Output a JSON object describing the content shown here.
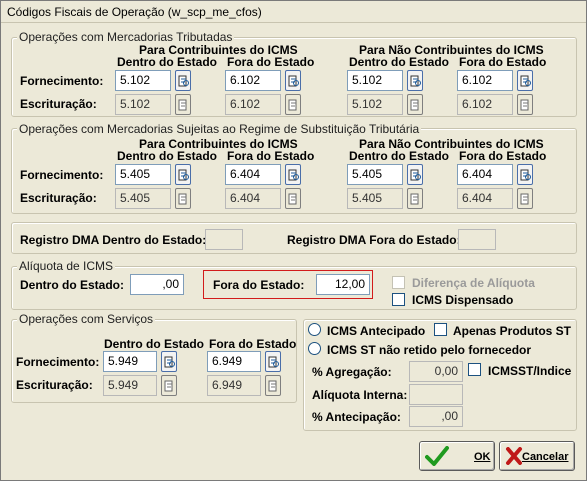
{
  "window": {
    "title": "Códigos Fiscais de Operação (w_scp_me_cfos)"
  },
  "tributadas": {
    "title": "Operações com Mercadorias Tributadas",
    "contribuintes": "Para Contribuintes do ICMS",
    "nao_contribuintes": "Para Não Contribuintes do ICMS",
    "dentro": "Dentro do Estado",
    "fora": "Fora do Estado",
    "fornecimento_label": "Fornecimento:",
    "escrituracao_label": "Escrituração:",
    "fornecimento": [
      "5.102",
      "6.102",
      "5.102",
      "6.102"
    ],
    "escrituracao": [
      "5.102",
      "6.102",
      "5.102",
      "6.102"
    ]
  },
  "st": {
    "title": "Operações com Mercadorias Sujeitas ao Regime de Substituição Tributária",
    "contribuintes": "Para Contribuintes do ICMS",
    "nao_contribuintes": "Para Não Contribuintes do ICMS",
    "dentro": "Dentro do Estado",
    "fora": "Fora do Estado",
    "fornecimento_label": "Fornecimento:",
    "escrituracao_label": "Escrituração:",
    "fornecimento": [
      "5.405",
      "6.404",
      "5.405",
      "6.404"
    ],
    "escrituracao": [
      "5.405",
      "6.404",
      "5.405",
      "6.404"
    ]
  },
  "dma": {
    "dentro_label": "Registro DMA Dentro do Estado:",
    "fora_label": "Registro DMA Fora do Estado:",
    "dentro_value": "",
    "fora_value": ""
  },
  "aliquota": {
    "title": "Alíquota de ICMS",
    "dentro_label": "Dentro do Estado:",
    "dentro_value": ",00",
    "fora_label": "Fora do Estado:",
    "fora_value": "12,00",
    "diferenca_label": "Diferença de Alíquota",
    "dispensado_label": "ICMS Dispensado"
  },
  "servicos": {
    "title": "Operações com Serviços",
    "dentro": "Dentro do Estado",
    "fora": "Fora do Estado",
    "fornecimento_label": "Fornecimento:",
    "escrituracao_label": "Escrituração:",
    "fornecimento": [
      "5.949",
      "6.949"
    ],
    "escrituracao": [
      "5.949",
      "6.949"
    ]
  },
  "icms_opts": {
    "antecipado": "ICMS Antecipado",
    "apenas_st": "Apenas Produtos ST",
    "nao_retido": "ICMS ST não retido pelo fornecedor",
    "agregacao_label": "% Agregação:",
    "agregacao_value": "0,00",
    "icmsst_indice": "ICMSST/Indice",
    "interna_label": "Alíquota Interna:",
    "interna_value": "",
    "antecipacao_label": "% Antecipação:",
    "antecipacao_value": ",00"
  },
  "buttons": {
    "ok": "OK",
    "cancelar": "Cancelar"
  }
}
